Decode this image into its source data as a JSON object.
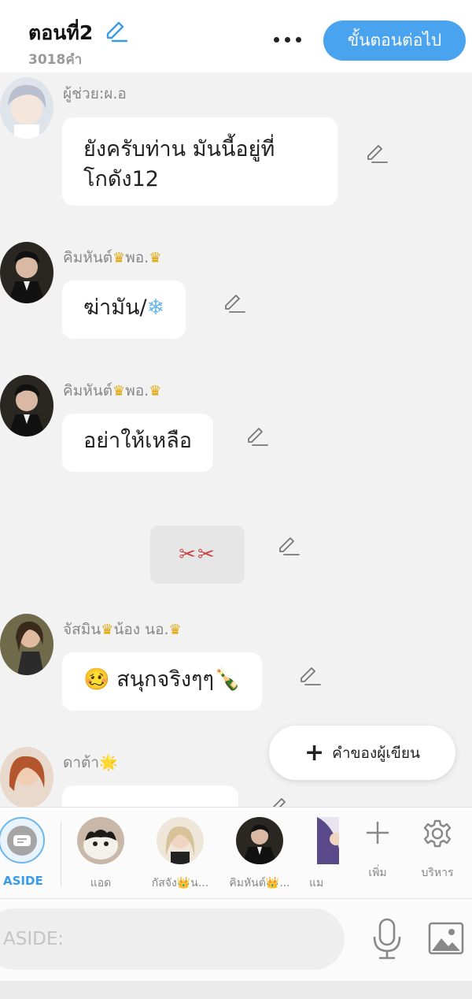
{
  "header": {
    "title": "ตอนที่2",
    "word_count": "3018คำ",
    "next_button": "ขั้นตอนต่อไป",
    "accent_color": "#4aa3ee"
  },
  "messages": [
    {
      "sender": "ผู้ช่วย:ผ.อ",
      "text_line1": "ยังครับท่าน มันนี้อยู่ที่",
      "text_line2": "โกดัง12"
    },
    {
      "sender_prefix": "คิมหันต์",
      "sender_mid": "พอ.",
      "text": "ฆ่ามัน/",
      "emoji": "❄"
    },
    {
      "sender_prefix": "คิมหันต์",
      "sender_mid": "พอ.",
      "text": "อย่าให้เหลือ"
    },
    {
      "note": "✂✂"
    },
    {
      "sender_prefix": "จัสมิน",
      "sender_mid": "น้อง นอ.",
      "emoji_face": "🥴",
      "text": "สนุกจริงๆๆ",
      "emoji_bottle": "🍾"
    },
    {
      "sender": "ดาต้า",
      "emoji": "🌟"
    }
  ],
  "author_button": {
    "label": "คำของผู้เขียน"
  },
  "character_bar": {
    "aside_label": "ASIDE",
    "characters": [
      {
        "name": "แอด"
      },
      {
        "name": "กัสจัง👑น..."
      },
      {
        "name": "คิมหันต์👑..."
      },
      {
        "name": "แม"
      }
    ],
    "add_label": "เพิ่ม",
    "manage_label": "บริหาร"
  },
  "composer": {
    "placeholder": "ASIDE:"
  },
  "icons": [
    "pencil-icon",
    "more-icon",
    "plus-icon",
    "gear-icon",
    "mic-icon",
    "image-icon",
    "crown-icon"
  ]
}
